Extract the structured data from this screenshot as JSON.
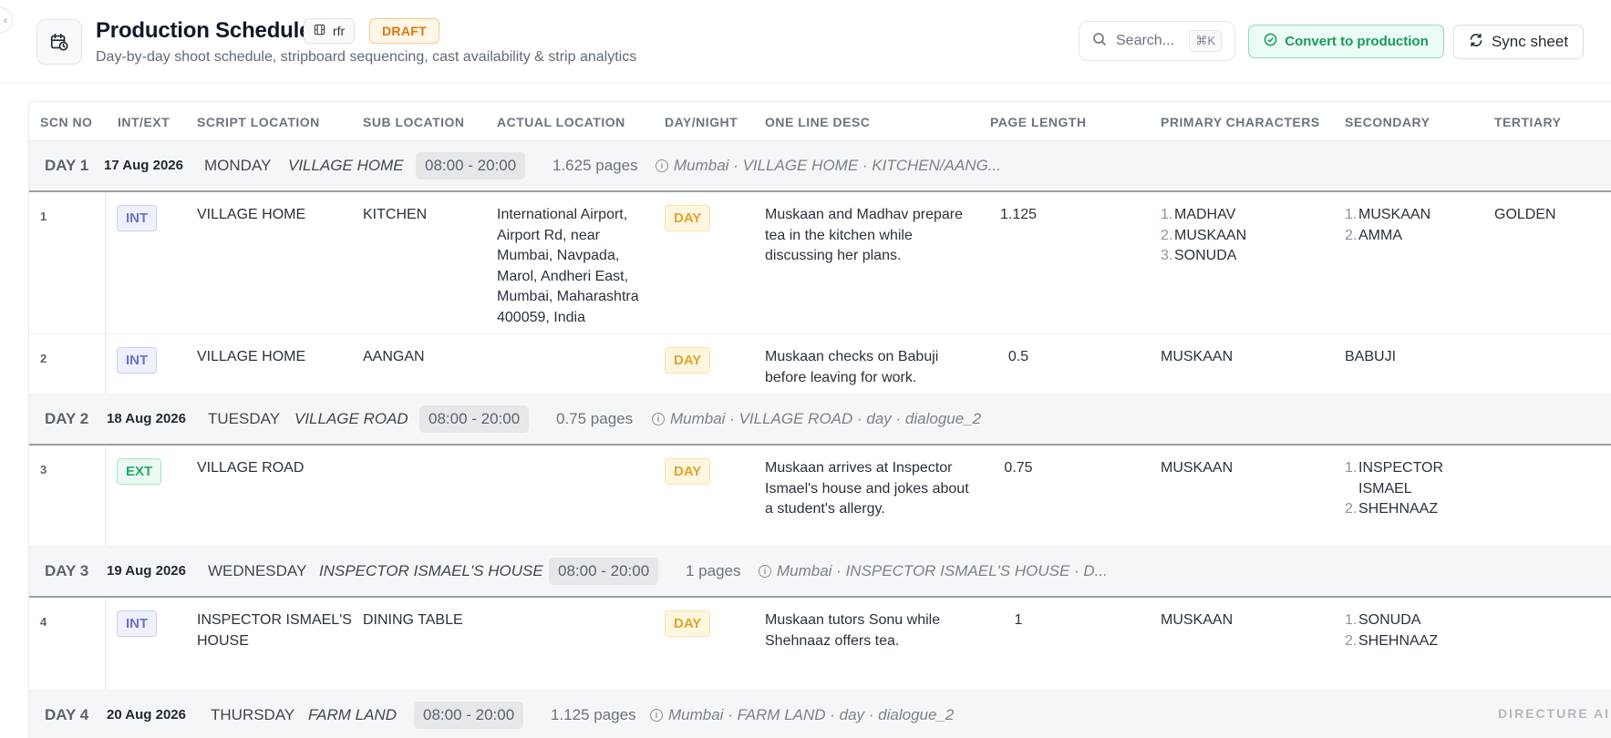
{
  "header": {
    "title": "Production Schedule",
    "chip_label": "rfr",
    "status_badge": "DRAFT",
    "subtitle": "Day-by-day shoot schedule, stripboard sequencing, cast availability & strip analytics",
    "search_placeholder": "Search...",
    "search_shortcut": "⌘K",
    "convert_label": "Convert to production",
    "sync_label": "Sync sheet"
  },
  "columns": [
    "SCN NO",
    "INT/EXT",
    "SCRIPT LOCATION",
    "SUB LOCATION",
    "ACTUAL LOCATION",
    "DAY/NIGHT",
    "ONE LINE DESC",
    "PAGE LENGTH",
    "PRIMARY CHARACTERS",
    "SECONDARY",
    "TERTIARY"
  ],
  "days": [
    {
      "day": "DAY 1",
      "date": "17 Aug 2026",
      "weekday": "MONDAY",
      "location": "VILLAGE HOME",
      "time": "08:00 - 20:00",
      "pages": "1.625 pages",
      "note": "Mumbai · VILLAGE HOME · KITCHEN/AANG...",
      "scenes": [
        {
          "no": "1",
          "int_ext": "INT",
          "script_location": "VILLAGE HOME",
          "sub_location": "KITCHEN",
          "actual_location": "International Airport, Airport Rd, near Mumbai, Navpada, Marol, Andheri East, Mumbai, Maharashtra 400059, India",
          "day_night": "DAY",
          "desc": "Muskaan and Madhav prepare tea in the kitchen while discussing her plans.",
          "page_length": "1.125",
          "primary": [
            "MADHAV",
            "MUSKAAN",
            "SONUDA"
          ],
          "secondary": [
            "MUSKAAN",
            "AMMA"
          ],
          "tertiary": "GOLDEN"
        },
        {
          "no": "2",
          "int_ext": "INT",
          "script_location": "VILLAGE HOME",
          "sub_location": "AANGAN",
          "actual_location": "",
          "day_night": "DAY",
          "desc": "Muskaan checks on Babuji before leaving for work.",
          "page_length": "0.5",
          "primary": "MUSKAAN",
          "secondary": "BABUJI",
          "tertiary": ""
        }
      ]
    },
    {
      "day": "DAY 2",
      "date": "18 Aug 2026",
      "weekday": "TUESDAY",
      "location": "VILLAGE ROAD",
      "time": "08:00 - 20:00",
      "pages": "0.75 pages",
      "note": "Mumbai · VILLAGE ROAD · day · dialogue_2",
      "scenes": [
        {
          "no": "3",
          "int_ext": "EXT",
          "script_location": "VILLAGE ROAD",
          "sub_location": "",
          "actual_location": "",
          "day_night": "DAY",
          "desc": "Muskaan arrives at Inspector Ismael's house and jokes about a student's allergy.",
          "page_length": "0.75",
          "primary": "MUSKAAN",
          "secondary": [
            "INSPECTOR ISMAEL",
            "SHEHNAAZ"
          ],
          "tertiary": ""
        }
      ]
    },
    {
      "day": "DAY 3",
      "date": "19 Aug 2026",
      "weekday": "WEDNESDAY",
      "location": "INSPECTOR ISMAEL'S HOUSE",
      "time": "08:00 - 20:00",
      "pages": "1 pages",
      "note": "Mumbai · INSPECTOR ISMAEL'S HOUSE · D...",
      "scenes": [
        {
          "no": "4",
          "int_ext": "INT",
          "script_location": "INSPECTOR ISMAEL'S HOUSE",
          "sub_location": "DINING TABLE",
          "actual_location": "",
          "day_night": "DAY",
          "desc": "Muskaan tutors Sonu while Shehnaaz offers tea.",
          "page_length": "1",
          "primary": "MUSKAAN",
          "secondary": [
            "SONUDA",
            "SHEHNAAZ"
          ],
          "tertiary": ""
        }
      ]
    },
    {
      "day": "DAY 4",
      "date": "20 Aug 2026",
      "weekday": "THURSDAY",
      "location": "FARM LAND",
      "time": "08:00 - 20:00",
      "pages": "1.125 pages",
      "note": "Mumbai · FARM LAND · day · dialogue_2",
      "scenes": []
    }
  ],
  "watermark": "DIRECTURE AI",
  "colors": {
    "draft": "#d97a06",
    "convert": "#179a5f",
    "int_tag": "#6a72d8",
    "ext_tag": "#26a86a",
    "day_tag": "#e0a32a"
  }
}
